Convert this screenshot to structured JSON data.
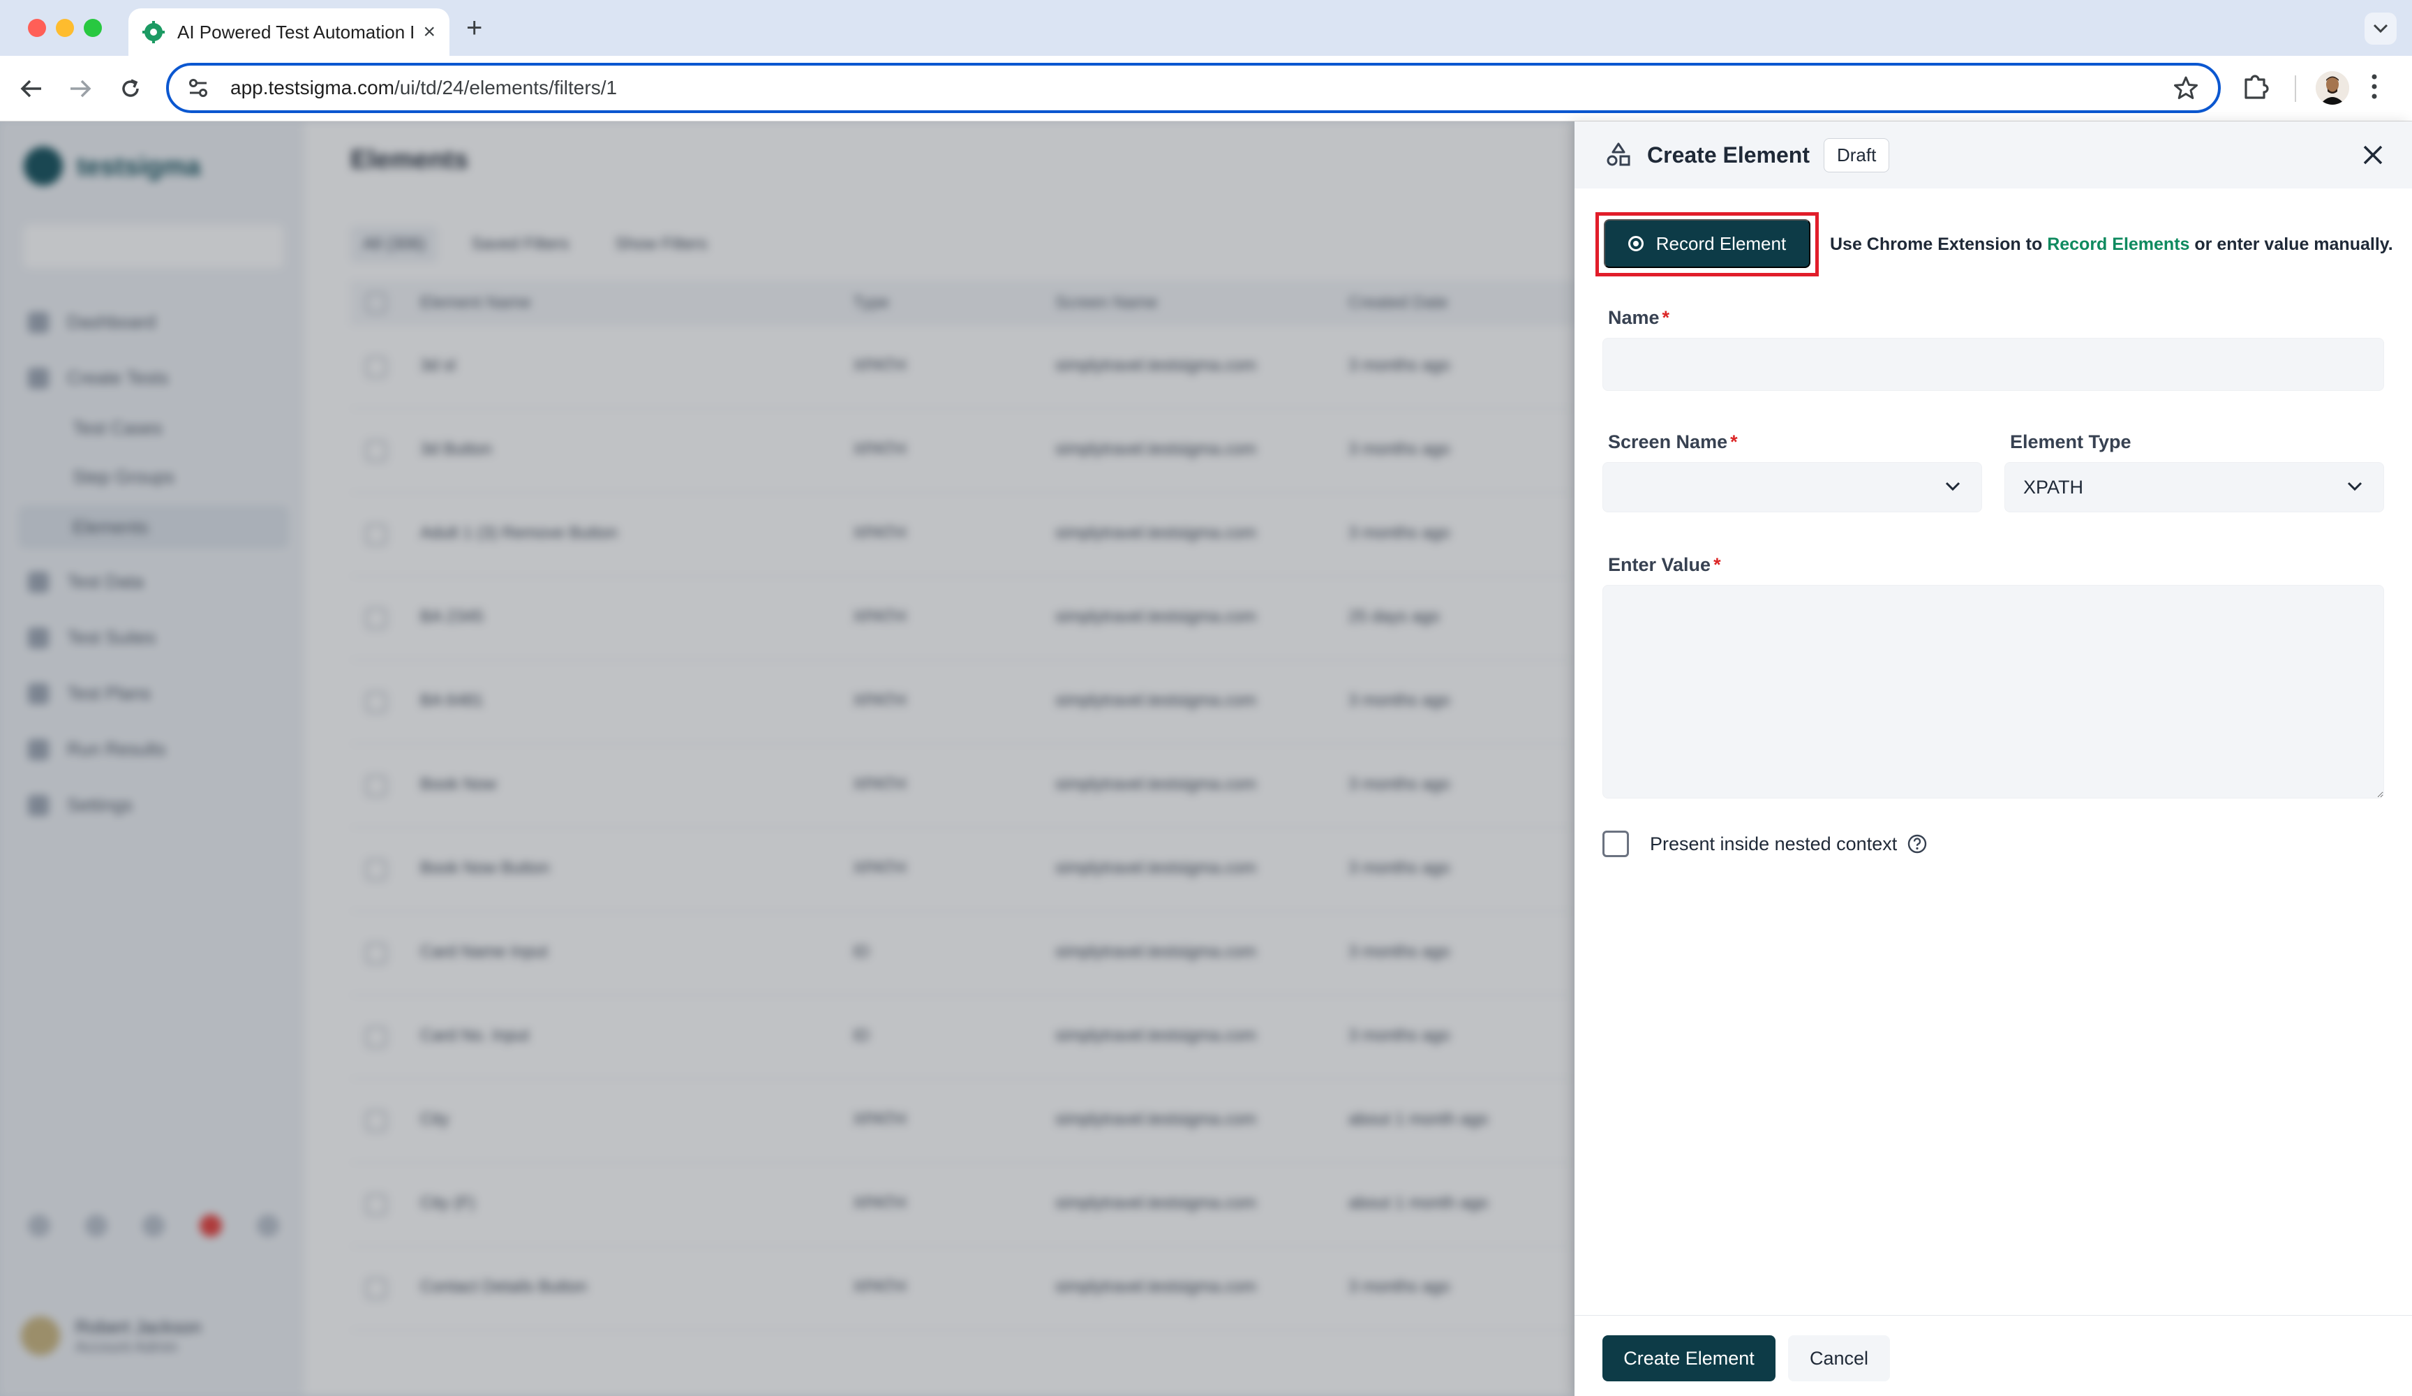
{
  "browser": {
    "tab_title": "AI Powered Test Automation P",
    "url_host": "app.testsigma.com",
    "url_path": "/ui/td/24/elements/filters/1"
  },
  "background": {
    "logo": "testsigma",
    "page_title": "Elements",
    "filters": [
      "All (306)",
      "Saved Filters",
      "Show Filters"
    ],
    "sidebar": [
      {
        "label": "Dashboard",
        "sub": false
      },
      {
        "label": "Create Tests",
        "sub": false
      },
      {
        "label": "Test Cases",
        "sub": true
      },
      {
        "label": "Step Groups",
        "sub": true
      },
      {
        "label": "Elements",
        "sub": true
      },
      {
        "label": "Test Data",
        "sub": false
      },
      {
        "label": "Test Suites",
        "sub": false
      },
      {
        "label": "Test Plans",
        "sub": false
      },
      {
        "label": "Run Results",
        "sub": false
      },
      {
        "label": "Settings",
        "sub": false
      }
    ],
    "user": {
      "name": "Robert Jackson",
      "role": "Account Admin"
    },
    "columns": [
      "Element Name",
      "Type",
      "Screen Name",
      "Created Date"
    ],
    "rows": [
      [
        "3d sl",
        "XPATH",
        "simplytravel.testsigma.com",
        "3 months ago"
      ],
      [
        "3d Button",
        "XPATH",
        "simplytravel.testsigma.com",
        "3 months ago"
      ],
      [
        "Adult 1 (3) Remove Button",
        "XPATH",
        "simplytravel.testsigma.com",
        "3 months ago"
      ],
      [
        "BA 2345",
        "XPATH",
        "simplytravel.testsigma.com",
        "25 days ago"
      ],
      [
        "BA 6481",
        "XPATH",
        "simplytravel.testsigma.com",
        "3 months ago"
      ],
      [
        "Book Now",
        "XPATH",
        "simplytravel.testsigma.com",
        "3 months ago"
      ],
      [
        "Book Now Button",
        "XPATH",
        "simplytravel.testsigma.com",
        "3 months ago"
      ],
      [
        "Card Name Input",
        "ID",
        "simplytravel.testsigma.com",
        "3 months ago"
      ],
      [
        "Card No. Input",
        "ID",
        "simplytravel.testsigma.com",
        "3 months ago"
      ],
      [
        "City",
        "XPATH",
        "simplytravel.testsigma.com",
        "about 1 month ago"
      ],
      [
        "City (F)",
        "XPATH",
        "simplytravel.testsigma.com",
        "about 1 month ago"
      ],
      [
        "Contact Details Button",
        "XPATH",
        "simplytravel.testsigma.com",
        "3 months ago"
      ]
    ]
  },
  "drawer": {
    "title": "Create Element",
    "badge": "Draft",
    "record_button": "Record Element",
    "hint_prefix": "Use Chrome Extension to",
    "hint_link": "Record Elements",
    "hint_suffix": "or enter value manually.",
    "name_label": "Name",
    "name_value": "",
    "screen_label": "Screen Name",
    "screen_value": "",
    "type_label": "Element Type",
    "type_value": "XPATH",
    "value_label": "Enter Value",
    "value_text": "",
    "nested_label": "Present inside nested context",
    "required_mark": "*",
    "create_button": "Create Element",
    "cancel_button": "Cancel"
  },
  "colors": {
    "primary": "#0d3b47",
    "highlight": "#e11d2a",
    "link": "#0f8a5f",
    "required": "#dc2626"
  }
}
